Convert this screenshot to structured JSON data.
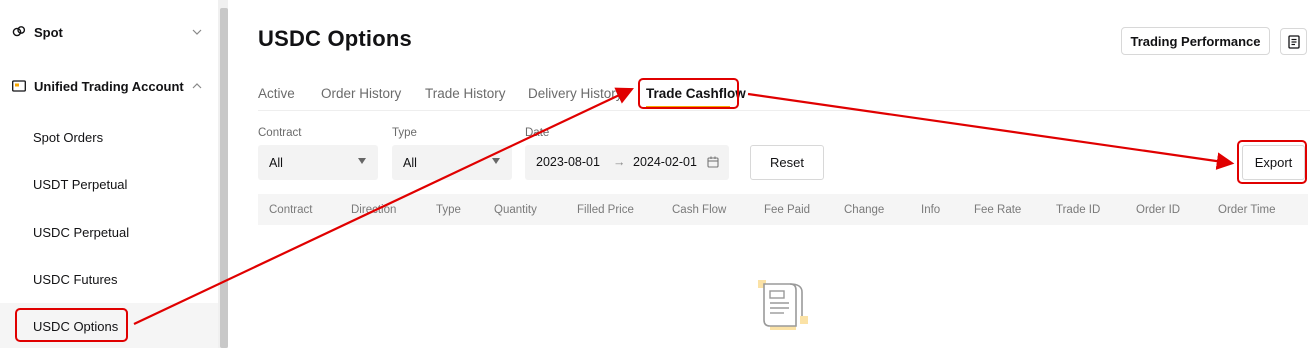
{
  "sidebar": {
    "spot": {
      "label": "Spot",
      "icon": "link-circles-icon",
      "chevron": "chevron-down-icon"
    },
    "unified": {
      "label": "Unified Trading Account",
      "icon": "wallet-icon",
      "chevron": "chevron-up-icon"
    },
    "sub_items": [
      "Spot Orders",
      "USDT Perpetual",
      "USDC Perpetual",
      "USDC Futures",
      "USDC Options"
    ],
    "active_item": "USDC Options"
  },
  "header": {
    "title": "USDC Options",
    "performance_button": "Trading Performance",
    "doc_icon": "document-icon"
  },
  "tabs": [
    "Active",
    "Order History",
    "Trade History",
    "Delivery History",
    "Trade Cashflow"
  ],
  "active_tab": "Trade Cashflow",
  "filters": {
    "contract": {
      "label": "Contract",
      "value": "All"
    },
    "type": {
      "label": "Type",
      "value": "All"
    },
    "date": {
      "label": "Date",
      "start": "2023-08-01",
      "end": "2024-02-01",
      "separator": "→"
    },
    "reset_button": "Reset",
    "export_button": "Export"
  },
  "table": {
    "columns": [
      "Contract",
      "Direction",
      "Type",
      "Quantity",
      "Filled Price",
      "Cash Flow",
      "Fee Paid",
      "Change",
      "Info",
      "Fee Rate",
      "Trade ID",
      "Order ID",
      "Order Time"
    ]
  },
  "empty_state": {
    "icon": "empty-document-icon"
  },
  "colors": {
    "accent": "#f7a600",
    "annotation": "#e00000"
  }
}
